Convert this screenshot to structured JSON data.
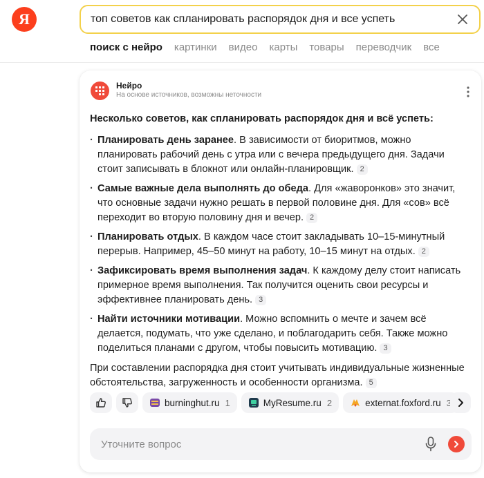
{
  "header": {
    "logo_letter": "Я",
    "search_query": "топ советов как спланировать распорядок дня и все успеть",
    "tabs": [
      {
        "label": "поиск с нейро",
        "active": true
      },
      {
        "label": "картинки",
        "active": false
      },
      {
        "label": "видео",
        "active": false
      },
      {
        "label": "карты",
        "active": false
      },
      {
        "label": "товары",
        "active": false
      },
      {
        "label": "переводчик",
        "active": false
      },
      {
        "label": "все",
        "active": false
      }
    ]
  },
  "card": {
    "title": "Нейро",
    "subtitle": "На основе источников, возможны неточности",
    "intro": "Несколько советов, как спланировать распорядок дня и всё успеть:",
    "items": [
      {
        "heading": "Планировать день заранее",
        "text": ". В зависимости от биоритмов, можно планировать рабочий день с утра или с вечера предыдущего дня. Задачи стоит записывать в блокнот или онлайн-планировщик.",
        "ref": "2"
      },
      {
        "heading": "Самые важные дела выполнять до обеда",
        "text": ". Для «жаворонков» это значит, что основные задачи нужно решать в первой половине дня. Для «сов» всё переходит во вторую половину дня и вечер.",
        "ref": "2"
      },
      {
        "heading": "Планировать отдых",
        "text": ". В каждом часе стоит закладывать 10–15-минутный перерыв. Например, 45–50 минут на работу, 10–15 минут на отдых.",
        "ref": "2"
      },
      {
        "heading": "Зафиксировать время выполнения задач",
        "text": ". К каждому делу стоит написать примерное время выполнения. Так получится оценить свои ресурсы и эффективнее планировать день.",
        "ref": "3"
      },
      {
        "heading": "Найти источники мотивации",
        "text": ". Можно вспомнить о мечте и зачем всё делается, подумать, что уже сделано, и поблагодарить себя. Также можно поделиться планами с другом, чтобы повысить мотивацию.",
        "ref": "3"
      }
    ],
    "outro": "При составлении распорядка дня стоит учитывать индивидуальные жизненные обстоятельства, загруженность и особенности организма.",
    "outro_ref": "5",
    "sources": [
      {
        "name": "burninghut.ru",
        "count": "1"
      },
      {
        "name": "MyResume.ru",
        "count": "2"
      },
      {
        "name": "externat.foxford.ru",
        "count": "3"
      }
    ],
    "ask_placeholder": "Уточните вопрос"
  },
  "colors": {
    "brand_red": "#fc3f1d",
    "search_border": "#f3d14b",
    "neuro_red": "#f04a3a",
    "chip_bg": "#f3f3f5"
  },
  "icons": [
    "clear-icon",
    "more-icon",
    "thumbs-up-icon",
    "thumbs-down-icon",
    "chevron-right-icon",
    "microphone-icon",
    "send-arrow-icon"
  ]
}
